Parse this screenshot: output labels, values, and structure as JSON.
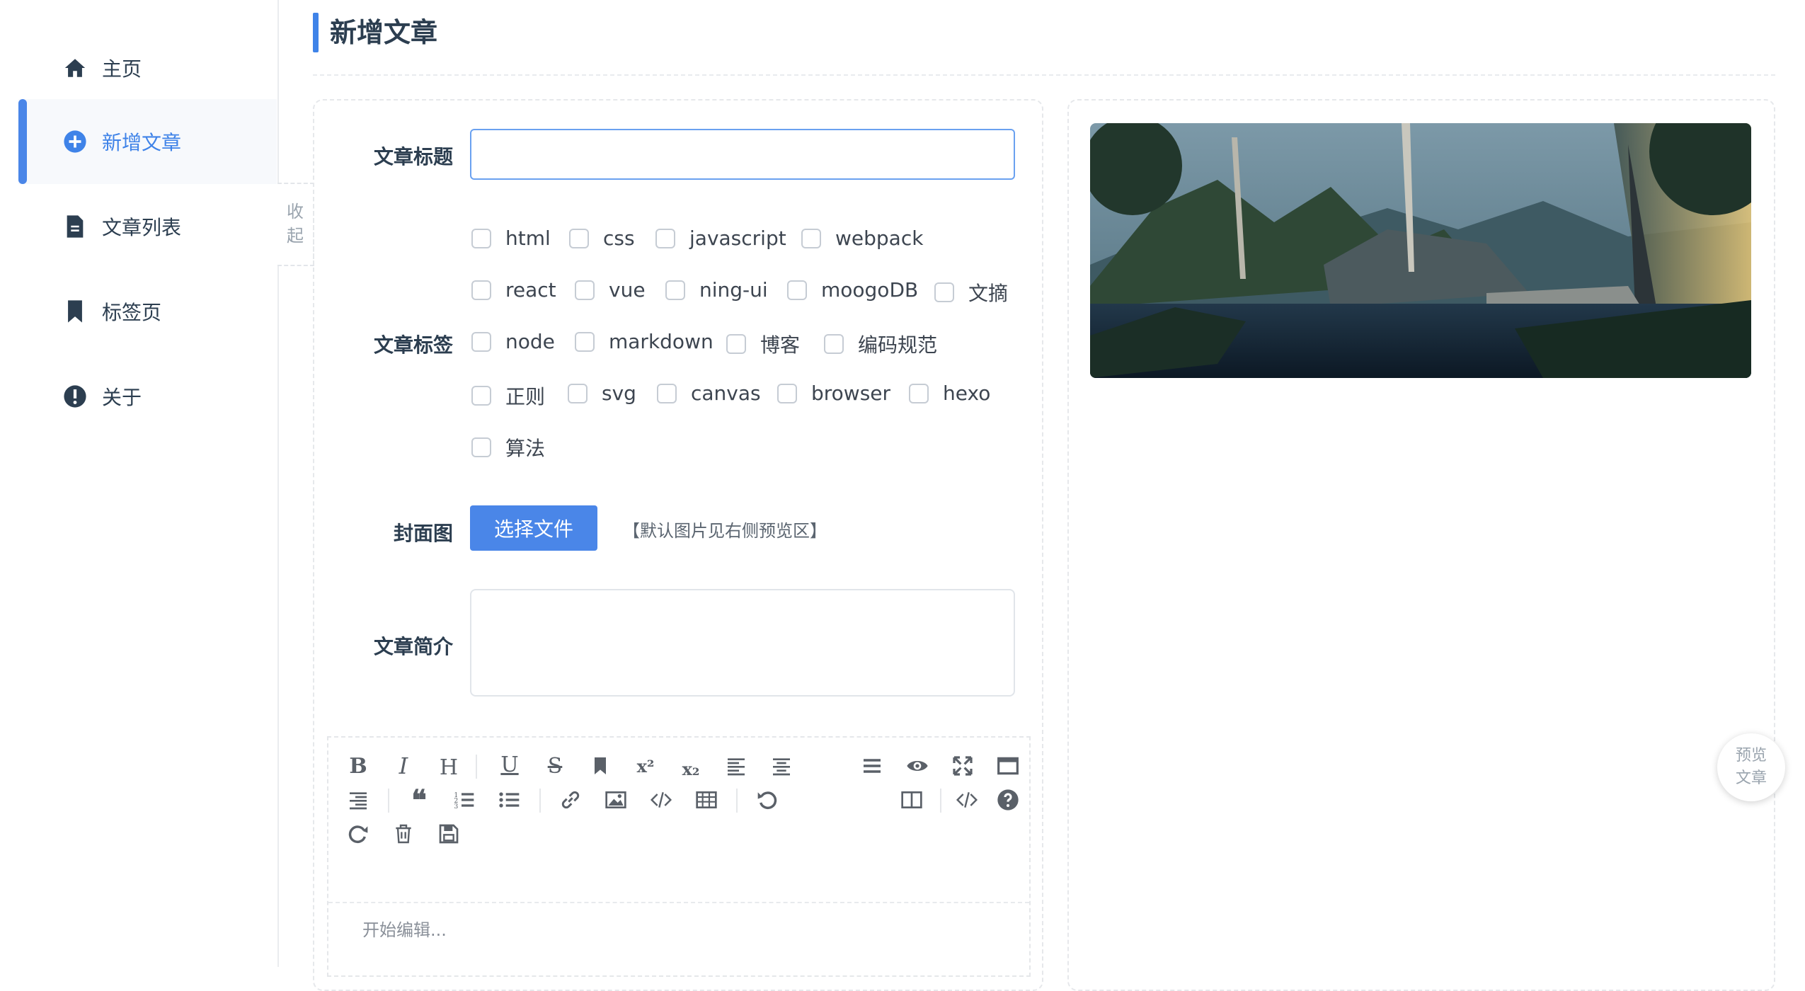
{
  "sidebar": {
    "items": [
      {
        "label": "主页",
        "icon": "home-icon"
      },
      {
        "label": "新增文章",
        "icon": "plus-circle-icon",
        "active": true
      },
      {
        "label": "文章列表",
        "icon": "document-icon"
      },
      {
        "label": "标签页",
        "icon": "bookmark-icon"
      },
      {
        "label": "关于",
        "icon": "info-icon"
      }
    ],
    "collapse_label_1": "收",
    "collapse_label_2": "起"
  },
  "header": {
    "title": "新增文章"
  },
  "form": {
    "title_label": "文章标题",
    "title_value": "",
    "tags_label": "文章标签",
    "tags": [
      "html",
      "css",
      "javascript",
      "webpack",
      "react",
      "vue",
      "ning-ui",
      "moogoDB",
      "文摘",
      "node",
      "markdown",
      "博客",
      "编码规范",
      "正则",
      "svg",
      "canvas",
      "browser",
      "hexo",
      "算法"
    ],
    "cover_label": "封面图",
    "cover_button": "选择文件",
    "cover_hint": "【默认图片见右侧预览区】",
    "summary_label": "文章简介",
    "summary_value": ""
  },
  "editor": {
    "placeholder": "开始编辑...",
    "toolbar": [
      "bold-icon",
      "italic-icon",
      "heading-icon",
      "underline-icon",
      "strikethrough-icon",
      "mark-icon",
      "superscript-icon",
      "subscript-icon",
      "align-left-icon",
      "align-center-icon",
      "align-right-icon",
      "quote-icon",
      "ordered-list-icon",
      "unordered-list-icon",
      "link-icon",
      "image-icon",
      "code-icon",
      "table-icon",
      "undo-icon",
      "redo-icon",
      "trash-icon",
      "save-icon",
      "navigation-icon",
      "preview-icon",
      "fullscreen-icon",
      "read-mode-icon",
      "subfield-icon",
      "html-code-icon",
      "help-icon"
    ]
  },
  "preview_button": {
    "line1": "预览",
    "line2": "文章"
  },
  "colors": {
    "accent": "#3f83e8",
    "button": "#4a86e8"
  }
}
